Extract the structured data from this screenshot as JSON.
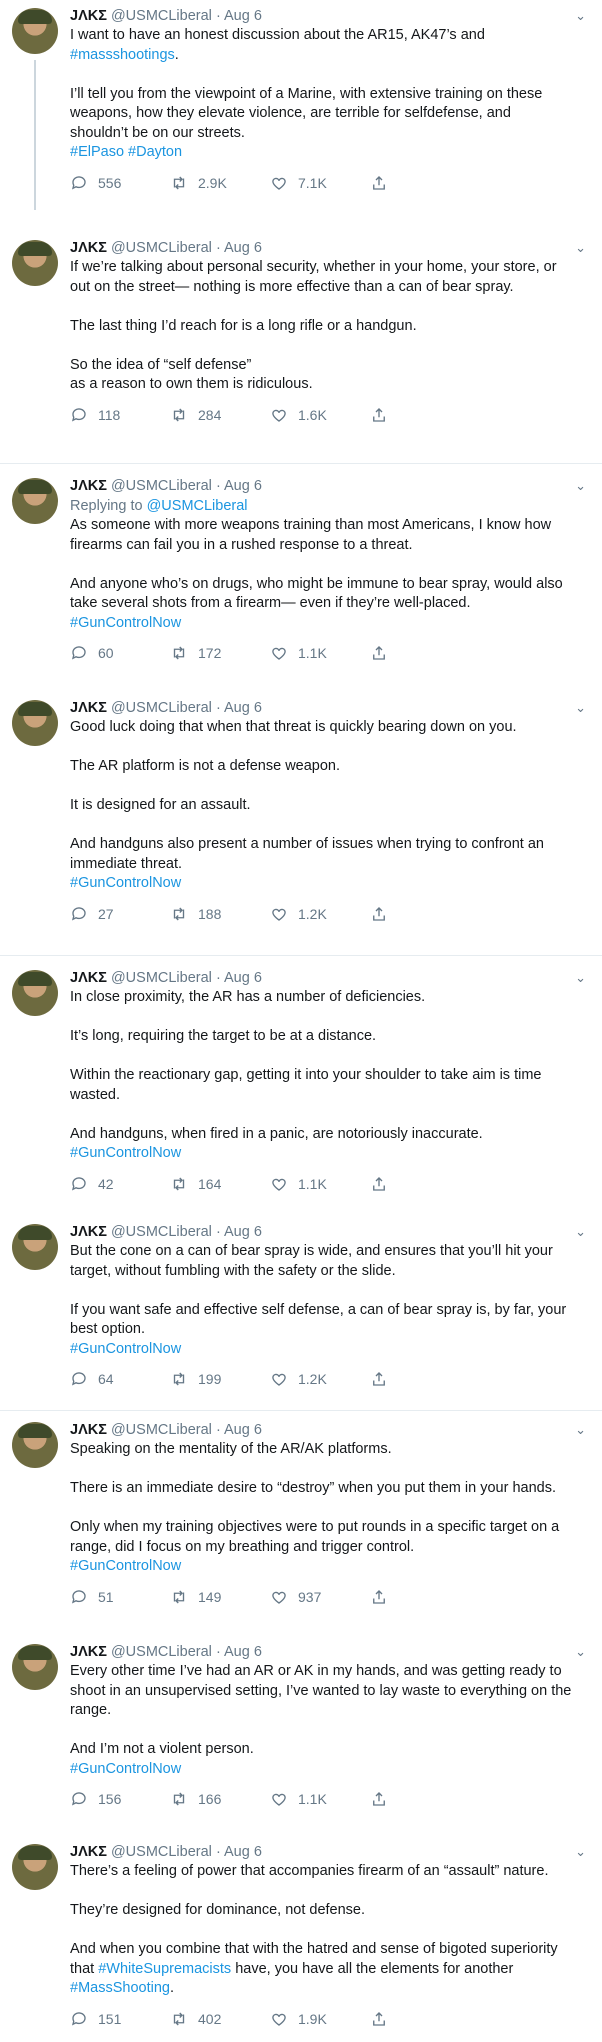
{
  "tweets": [
    {
      "name": "JΛKΣ",
      "handle": "@USMCLiberal",
      "date": "· Aug 6",
      "p1": "I want to have an honest discussion about the AR15, AK47’s and",
      "p1_link": "#massshootings",
      "p1_tail": ".",
      "p2": "I’ll tell you from the viewpoint of a Marine, with extensive training on these weapons, how they elevate violence, are terrible for selfdefense, and shouldn’t be on our streets.",
      "tags": "#ElPaso #Dayton",
      "replies": "556",
      "retweets": "2.9K",
      "likes": "7.1K"
    },
    {
      "name": "JΛKΣ",
      "handle": "@USMCLiberal",
      "date": "· Aug 6",
      "p1": "If we’re talking about personal security, whether in your home, your store, or out on the street— nothing is more effective than a can of bear spray.",
      "p2": "The last thing I’d reach for is a long rifle or a handgun.",
      "p3a": "So the idea of “self defense”",
      "p3b": "as a reason to own them is ridiculous.",
      "replies": "118",
      "retweets": "284",
      "likes": "1.6K"
    },
    {
      "name": "JΛKΣ",
      "handle": "@USMCLiberal",
      "date": "· Aug 6",
      "replying": "Replying to",
      "replying_to": "@USMCLiberal",
      "p1": "As someone with more weapons training than most  Americans, I know how firearms can fail you in a rushed response to a threat.",
      "p2": "And anyone who’s on drugs, who might be immune to bear spray, would also take several shots from a firearm— even if they’re well-placed.",
      "tags": "#GunControlNow",
      "replies": "60",
      "retweets": "172",
      "likes": "1.1K"
    },
    {
      "name": "JΛKΣ",
      "handle": "@USMCLiberal",
      "date": "· Aug 6",
      "p1": "Good luck doing that when that threat is quickly bearing down on you.",
      "p2": "The AR platform is not a defense weapon.",
      "p3": "It is designed for an assault.",
      "p4": "And handguns also present a number of issues when trying to confront an immediate threat.",
      "tags": "#GunControlNow",
      "replies": "27",
      "retweets": "188",
      "likes": "1.2K"
    },
    {
      "name": "JΛKΣ",
      "handle": "@USMCLiberal",
      "date": "· Aug 6",
      "p1": "In close proximity, the AR has a number of deficiencies.",
      "p2": "It’s long, requiring the target to be at a distance.",
      "p3": "Within the reactionary gap, getting it into your shoulder to take aim is time wasted.",
      "p4": "And handguns, when fired in a panic, are notoriously inaccurate.",
      "tags": "#GunControlNow",
      "replies": "42",
      "retweets": "164",
      "likes": "1.1K"
    },
    {
      "name": "JΛKΣ",
      "handle": "@USMCLiberal",
      "date": "· Aug 6",
      "p1": "But the cone on a can of bear spray is wide, and ensures that you’ll hit your target, without fumbling with the safety or the slide.",
      "p2": "If you want safe and effective self defense, a can of bear spray is, by far, your best option.",
      "tags": "#GunControlNow",
      "replies": "64",
      "retweets": "199",
      "likes": "1.2K"
    },
    {
      "name": "JΛKΣ",
      "handle": "@USMCLiberal",
      "date": "· Aug 6",
      "p1": "Speaking on the mentality of the AR/AK platforms.",
      "p2": "There is an immediate desire to “destroy” when you put them in your hands.",
      "p3": "Only when my training objectives were to put rounds in a specific target on a range, did I focus on my breathing and trigger control.",
      "tags": "#GunControlNow",
      "replies": "51",
      "retweets": "149",
      "likes": "937"
    },
    {
      "name": "JΛKΣ",
      "handle": "@USMCLiberal",
      "date": "· Aug 6",
      "p1": "Every other time I’ve had an AR or AK in my hands, and was getting ready to shoot in an unsupervised setting, I’ve wanted to lay waste to everything on the range.",
      "p2": "And I’m not a violent person.",
      "tags": "#GunControlNow",
      "replies": "156",
      "retweets": "166",
      "likes": "1.1K"
    },
    {
      "name": "JΛKΣ",
      "handle": "@USMCLiberal",
      "date": "· Aug 6",
      "p1": "There’s a feeling of power that accompanies firearm of an “assault” nature.",
      "p2": "They’re designed for dominance, not defense.",
      "p3_pre": "And when you combine that with the hatred and sense of bigoted superiority that",
      "p3_link1": "#WhiteSupremacists",
      "p3_mid": "have, you have all the elements for another",
      "p3_link2": "#MassShooting",
      "p3_tail": ".",
      "replies": "151",
      "retweets": "402",
      "likes": "1.9K"
    }
  ],
  "colors": {
    "link": "#1b95e0",
    "muted": "#657786",
    "text": "#14171a"
  },
  "icons": {
    "reply": "reply-icon",
    "retweet": "retweet-icon",
    "like": "like-icon",
    "share": "share-icon",
    "menu": "chevron-down-icon"
  }
}
